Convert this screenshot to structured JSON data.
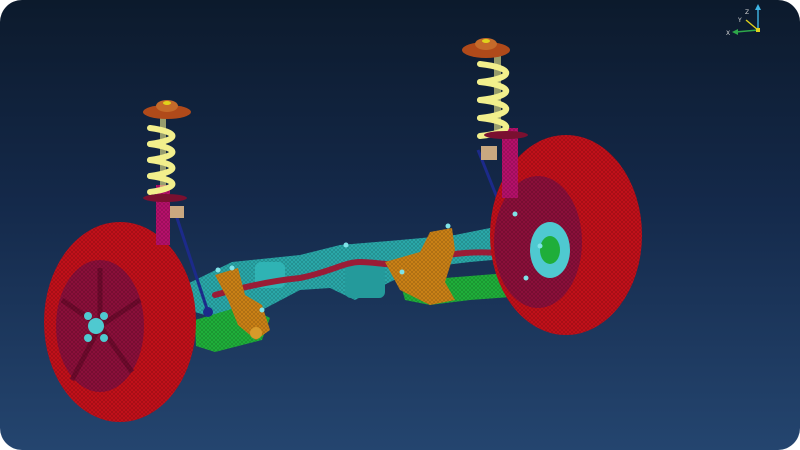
{
  "viewer": {
    "background_top": "#0c1a2c",
    "background_bottom": "#24456f"
  },
  "triad": {
    "x_label": "X",
    "y_label": "Y",
    "z_label": "Z",
    "x_color": "#2ea84a",
    "y_color": "#e0d21c",
    "z_color": "#3fb6e6"
  },
  "model": {
    "colors": {
      "tire": "#c0101a",
      "rim": "#8a0f3a",
      "hub": "#4fc9d0",
      "spring": "#f2ef8c",
      "strut": "#b5106a",
      "mount": "#b04a1a",
      "subframe": "#2aa7a8",
      "control_arm": "#1fae3a",
      "knuckle": "#c98016",
      "tie_rod": "#3a1b8a",
      "stabilizer": "#9a1c36"
    }
  }
}
